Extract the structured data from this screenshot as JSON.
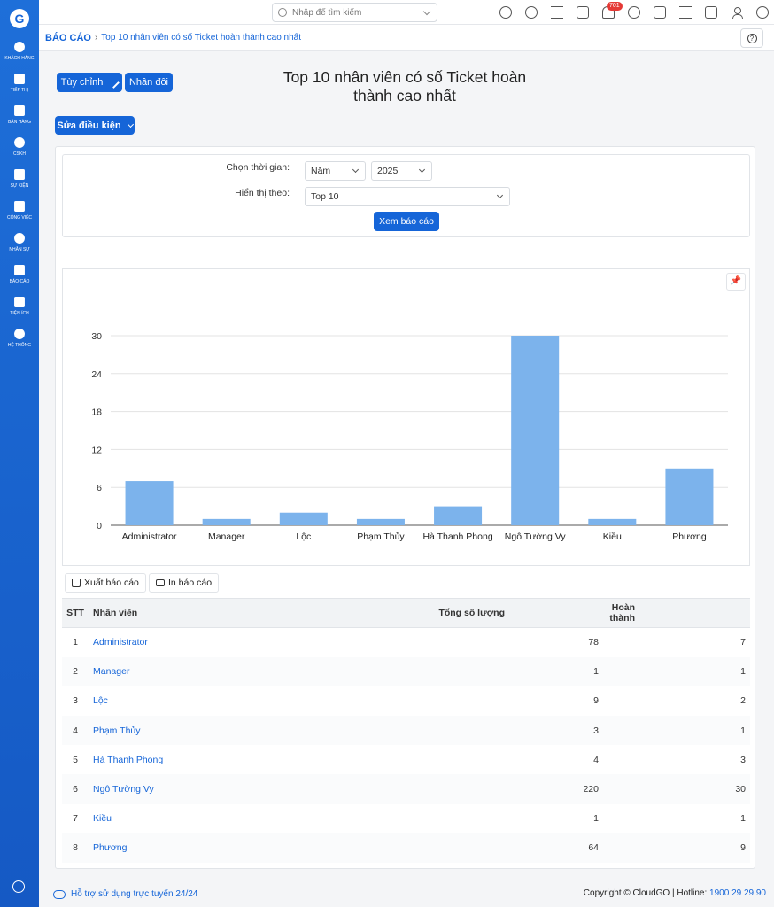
{
  "sidebar": {
    "logo": "G",
    "items": [
      {
        "label": "KHÁCH HÀNG",
        "icon": "users-icon"
      },
      {
        "label": "TIẾP THỊ",
        "icon": "megaphone-icon"
      },
      {
        "label": "BÁN HÀNG",
        "icon": "cart-icon"
      },
      {
        "label": "CSKH",
        "icon": "support-icon"
      },
      {
        "label": "SỰ KIỆN",
        "icon": "calendar-icon"
      },
      {
        "label": "CÔNG VIỆC",
        "icon": "briefcase-icon"
      },
      {
        "label": "NHÂN SỰ",
        "icon": "person-icon"
      },
      {
        "label": "BÁO CÁO",
        "icon": "report-icon"
      },
      {
        "label": "TIỆN ÍCH",
        "icon": "box-icon"
      },
      {
        "label": "HỆ THỐNG",
        "icon": "wrench-icon"
      }
    ]
  },
  "topbar": {
    "search_placeholder": "Nhập để tìm kiếm",
    "notification_count": "701"
  },
  "breadcrumb": {
    "root": "BÁO CÁO",
    "current": "Top 10 nhân viên có số Ticket hoàn thành cao nhất"
  },
  "actions": {
    "customize": "Tùy chỉnh",
    "duplicate": "Nhân đôi",
    "edit_conditions": "Sửa điều kiện"
  },
  "report": {
    "title": "Top 10 nhân viên có số Ticket hoàn thành cao nhất"
  },
  "filters": {
    "time_label": "Chọn thời gian:",
    "time_unit": "Năm",
    "year": "2025",
    "display_label": "Hiển thị theo:",
    "display_value": "Top 10",
    "view_button": "Xem báo cáo"
  },
  "chart_data": {
    "type": "bar",
    "categories": [
      "Administrator",
      "Manager",
      "Lộc",
      "Phạm Thủy",
      "Hà Thanh Phong",
      "Ngô Tường Vy",
      "Kiều",
      "Phương"
    ],
    "values": [
      7,
      1,
      2,
      1,
      3,
      30,
      1,
      9
    ],
    "yticks": [
      0,
      6,
      12,
      18,
      24,
      30
    ],
    "ylim": [
      0,
      30
    ],
    "color": "#7cb3ec",
    "grid": true
  },
  "tools": {
    "export": "Xuất báo cáo",
    "print": "In báo cáo"
  },
  "table": {
    "headers": [
      "STT",
      "Nhân viên",
      "Tổng số lượng",
      "Hoàn thành"
    ],
    "rows": [
      {
        "stt": "1",
        "name": "Administrator",
        "total": "78",
        "done": "7"
      },
      {
        "stt": "2",
        "name": "Manager",
        "total": "1",
        "done": "1"
      },
      {
        "stt": "3",
        "name": "Lộc",
        "total": "9",
        "done": "2"
      },
      {
        "stt": "4",
        "name": "Phạm Thủy",
        "total": "3",
        "done": "1"
      },
      {
        "stt": "5",
        "name": "Hà Thanh Phong",
        "total": "4",
        "done": "3"
      },
      {
        "stt": "6",
        "name": "Ngô Tường Vy",
        "total": "220",
        "done": "30"
      },
      {
        "stt": "7",
        "name": "Kiều",
        "total": "1",
        "done": "1"
      },
      {
        "stt": "8",
        "name": "Phương",
        "total": "64",
        "done": "9"
      }
    ]
  },
  "footer": {
    "support": "Hỗ trợ sử dụng trực tuyến 24/24",
    "copyright": "Copyright © CloudGO | Hotline: ",
    "hotline": "1900 29 29 90"
  }
}
